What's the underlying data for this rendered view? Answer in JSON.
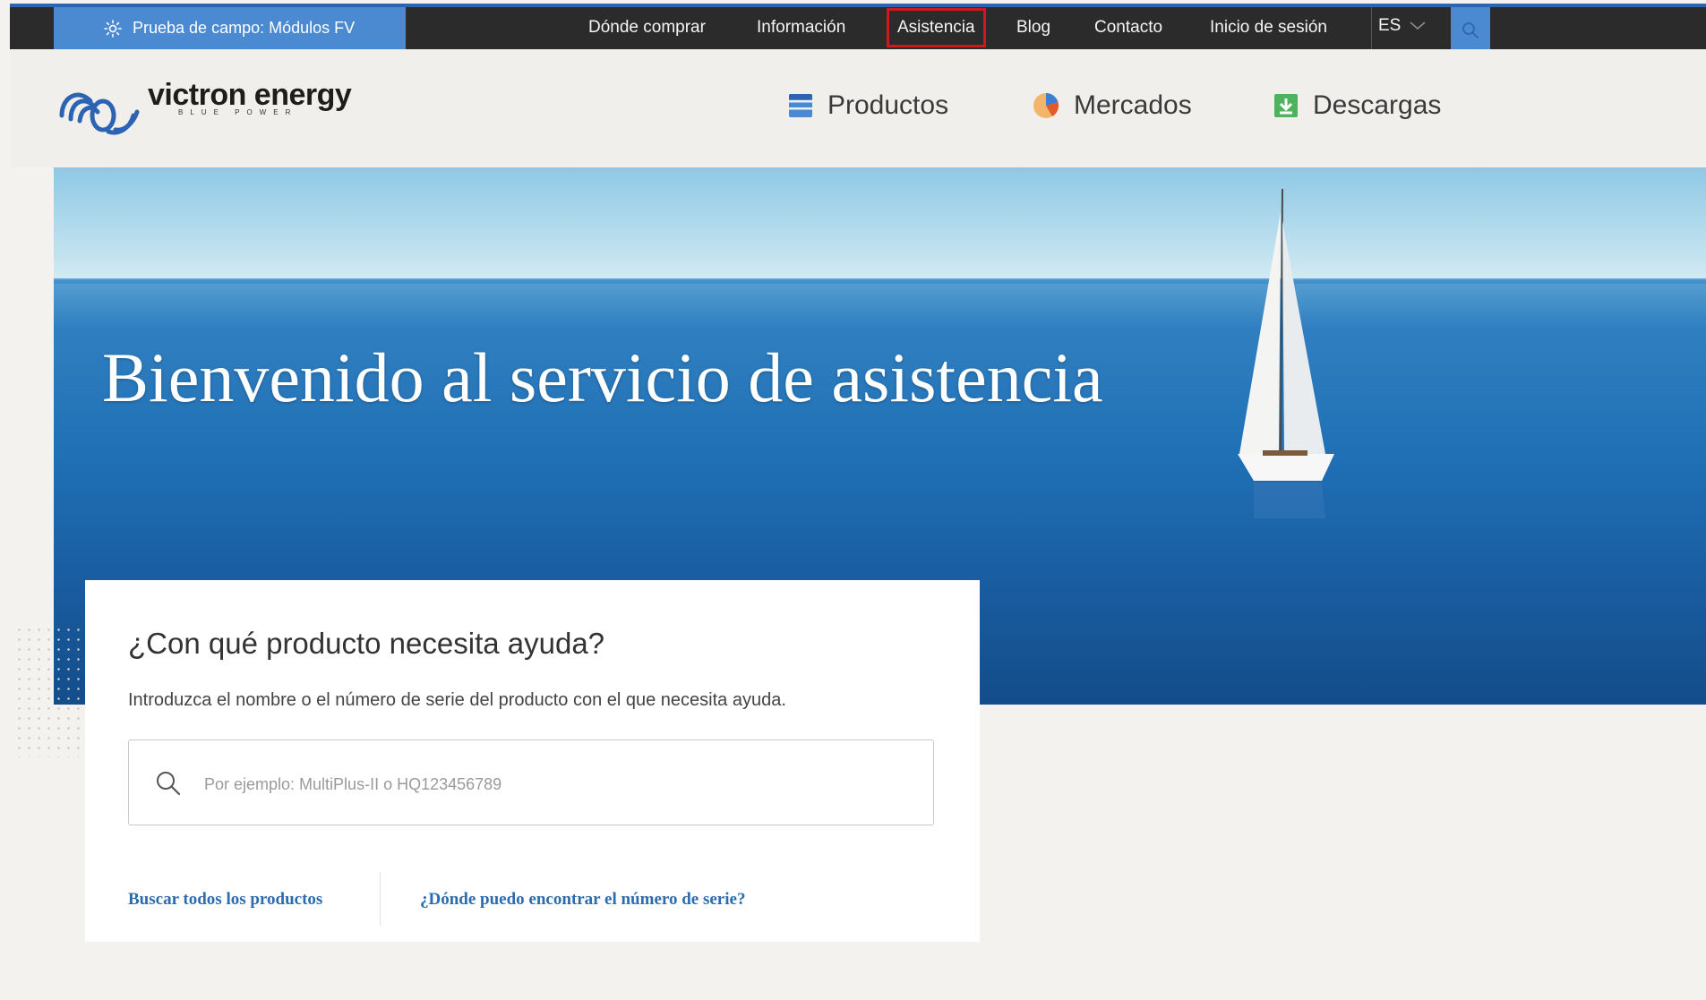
{
  "topbar": {
    "promo": {
      "label": "Prueba de campo: Módulos FV",
      "icon": "sun-icon"
    },
    "nav": [
      {
        "label": "Dónde comprar"
      },
      {
        "label": "Información"
      },
      {
        "label": "Asistencia",
        "highlighted": true
      },
      {
        "label": "Blog"
      },
      {
        "label": "Contacto"
      },
      {
        "label": "Inicio de sesión"
      }
    ],
    "language": "ES",
    "search_icon": "search-icon",
    "colors": {
      "bar": "#2b2b2b",
      "accent": "#4b8ad1",
      "highlight_border": "#d2171c"
    }
  },
  "header": {
    "logo": {
      "name": "victron energy",
      "tagline": "BLUE POWER"
    },
    "nav": [
      {
        "label": "Productos",
        "icon": "products-icon"
      },
      {
        "label": "Mercados",
        "icon": "markets-pie-icon"
      },
      {
        "label": "Descargas",
        "icon": "download-icon"
      }
    ]
  },
  "hero": {
    "title": "Bienvenido al servicio de asistencia"
  },
  "search_card": {
    "title": "¿Con qué producto necesita ayuda?",
    "description": "Introduzca el nombre o el número de serie del producto con el que necesita ayuda.",
    "placeholder": "Por ejemplo: MultiPlus-II o HQ123456789",
    "value": "",
    "links": [
      {
        "label": "Buscar todos los productos"
      },
      {
        "label": "¿Dónde puedo encontrar el número de serie?"
      }
    ],
    "link_color": "#2b6bb0"
  }
}
